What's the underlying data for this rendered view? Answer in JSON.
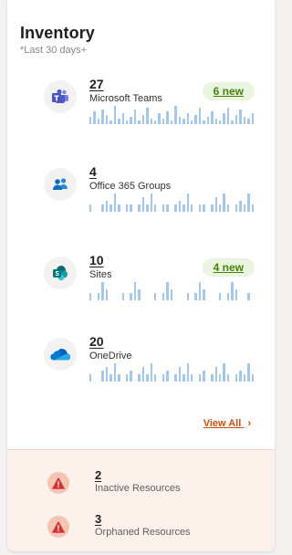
{
  "inventory": {
    "title": "Inventory",
    "subtitle": "*Last 30 days+",
    "items": [
      {
        "count": "27",
        "label": "Microsoft Teams",
        "badge": "6 new",
        "icon": "teams-icon",
        "trend": [
          4,
          7,
          3,
          8,
          5,
          2,
          10,
          3,
          6,
          2,
          4,
          8,
          2,
          5,
          9,
          3,
          2,
          6,
          3,
          7,
          2,
          10,
          4,
          3,
          6,
          2,
          5,
          9,
          2,
          4,
          7,
          3,
          2,
          6,
          9,
          2,
          5,
          8,
          4,
          3,
          6
        ]
      },
      {
        "count": "4",
        "label": "Office 365 Groups",
        "badge": "",
        "icon": "groups-icon",
        "trend": [
          2,
          0,
          0,
          2,
          3,
          2,
          5,
          2,
          0,
          2,
          2,
          0,
          2,
          4,
          2,
          5,
          2,
          0,
          2,
          2,
          0,
          2,
          3,
          2,
          5,
          2,
          0,
          2,
          2,
          0,
          2,
          4,
          2,
          5,
          2,
          0,
          2,
          3,
          2,
          5,
          2
        ]
      },
      {
        "count": "10",
        "label": "Sites",
        "badge": "4 new",
        "icon": "sharepoint-icon",
        "trend": [
          2,
          0,
          2,
          5,
          3,
          0,
          0,
          0,
          2,
          0,
          2,
          5,
          3,
          0,
          0,
          0,
          2,
          0,
          2,
          5,
          3,
          0,
          0,
          0,
          2,
          0,
          2,
          5,
          3,
          0,
          0,
          0,
          2,
          0,
          2,
          5,
          3,
          0,
          0,
          2,
          0
        ]
      },
      {
        "count": "20",
        "label": "OneDrive",
        "badge": "",
        "icon": "onedrive-icon",
        "trend": [
          2,
          0,
          0,
          3,
          4,
          2,
          5,
          2,
          0,
          2,
          3,
          0,
          2,
          4,
          2,
          5,
          2,
          0,
          2,
          3,
          0,
          2,
          4,
          2,
          5,
          2,
          0,
          2,
          3,
          0,
          2,
          4,
          2,
          5,
          2,
          0,
          2,
          3,
          2,
          5,
          2
        ]
      }
    ],
    "view_all": "View All",
    "view_all_chevron": "›"
  },
  "alerts": [
    {
      "count": "2",
      "label": "Inactive Resources",
      "icon": "warning-icon"
    },
    {
      "count": "3",
      "label": "Orphaned Resources",
      "icon": "warning-icon"
    }
  ],
  "colors": {
    "spark": "#a3c8ec",
    "badge_text": "#498205",
    "badge_bg": "#e9f4e1",
    "link": "#ca5010",
    "alert_bg": "#fdf1ec",
    "warning": "#d13438"
  }
}
